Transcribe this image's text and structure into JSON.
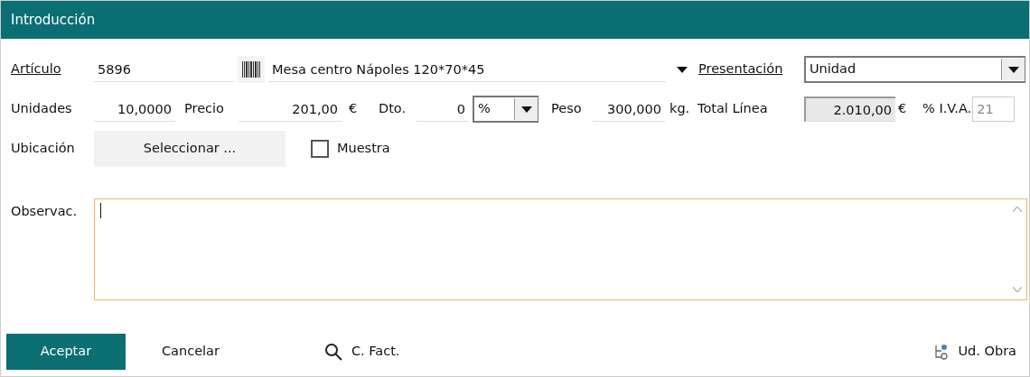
{
  "window": {
    "title": "Introducción"
  },
  "article": {
    "label": "Artículo",
    "code": "5896",
    "description": "Mesa centro Nápoles 120*70*45",
    "presentation_label": "Presentación",
    "presentation": "Unidad"
  },
  "line": {
    "units_label": "Unidades",
    "units": "10,0000",
    "price_label": "Precio",
    "price": "201,00",
    "price_currency": "€",
    "discount_label": "Dto.",
    "discount": "0",
    "discount_type": "%",
    "weight_label": "Peso",
    "weight": "300,000",
    "weight_unit": "kg.",
    "total_label": "Total Línea",
    "total": "2.010,00",
    "total_currency": "€",
    "vat_label": "% I.V.A.",
    "vat": "21",
    "vat_disabled": true
  },
  "location": {
    "label": "Ubicación",
    "button": "Seleccionar ..."
  },
  "sample": {
    "label": "Muestra",
    "checked": false
  },
  "notes": {
    "label": "Observac.",
    "focused": true
  },
  "buttons": [
    {
      "kind": "primary",
      "label": "Aceptar"
    },
    {
      "kind": "plain",
      "label": "Cancelar"
    },
    {
      "kind": "search",
      "label": "C. Fact."
    },
    {
      "kind": "units",
      "label": "Ud. Obra"
    }
  ]
}
